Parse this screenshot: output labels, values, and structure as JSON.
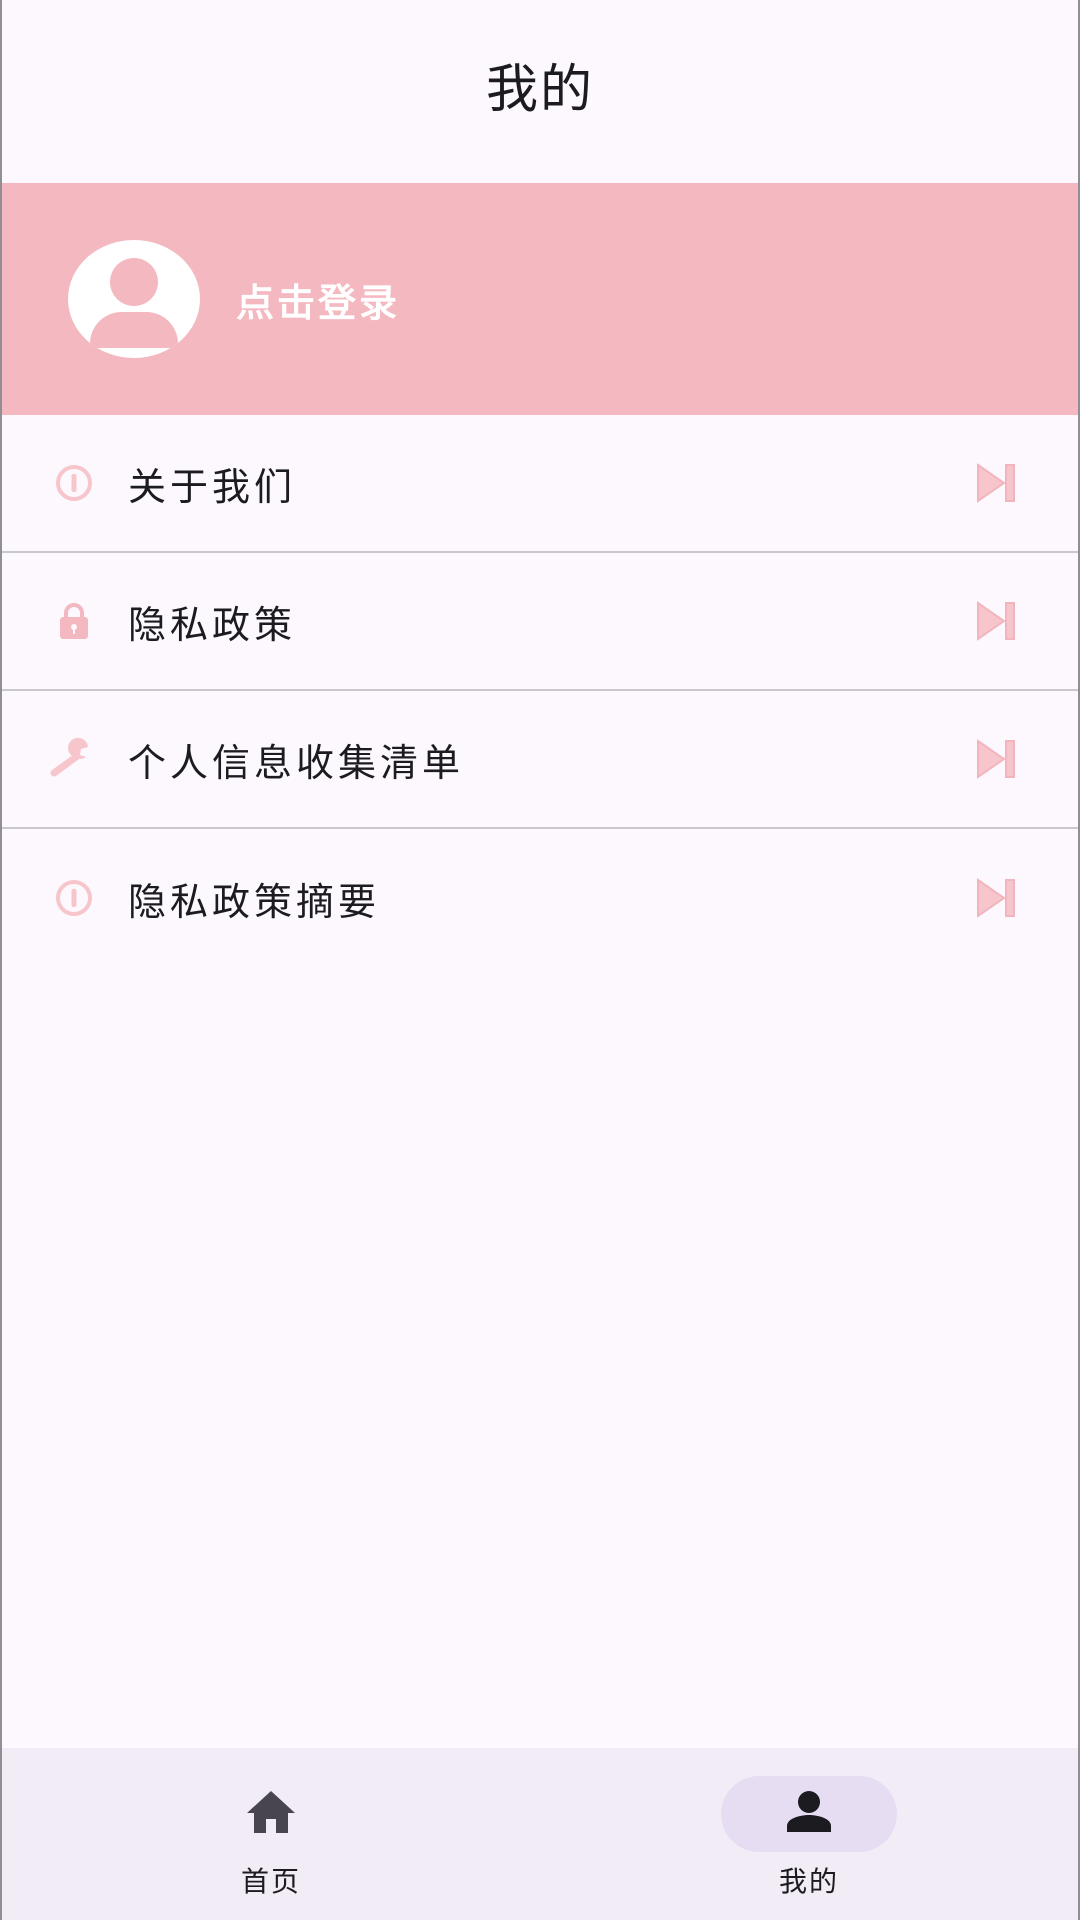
{
  "header": {
    "title": "我的"
  },
  "login": {
    "label": "点击登录"
  },
  "menu": {
    "items": [
      {
        "label": "关于我们",
        "icon": "info-icon"
      },
      {
        "label": "隐私政策",
        "icon": "lock-icon"
      },
      {
        "label": "个人信息收集清单",
        "icon": "wrench-icon"
      },
      {
        "label": "隐私政策摘要",
        "icon": "info-icon"
      }
    ],
    "arrow_icon": "skip-next-icon"
  },
  "bottom_nav": {
    "items": [
      {
        "label": "首页",
        "icon": "home-icon",
        "active": false
      },
      {
        "label": "我的",
        "icon": "person-icon",
        "active": true
      }
    ]
  },
  "colors": {
    "accent": "#f4b8c0",
    "icon_pink": "#f7c6cc",
    "background": "#fcf8fd",
    "nav_background": "#f2ecf6",
    "nav_active_pill": "#e6ddf3"
  }
}
